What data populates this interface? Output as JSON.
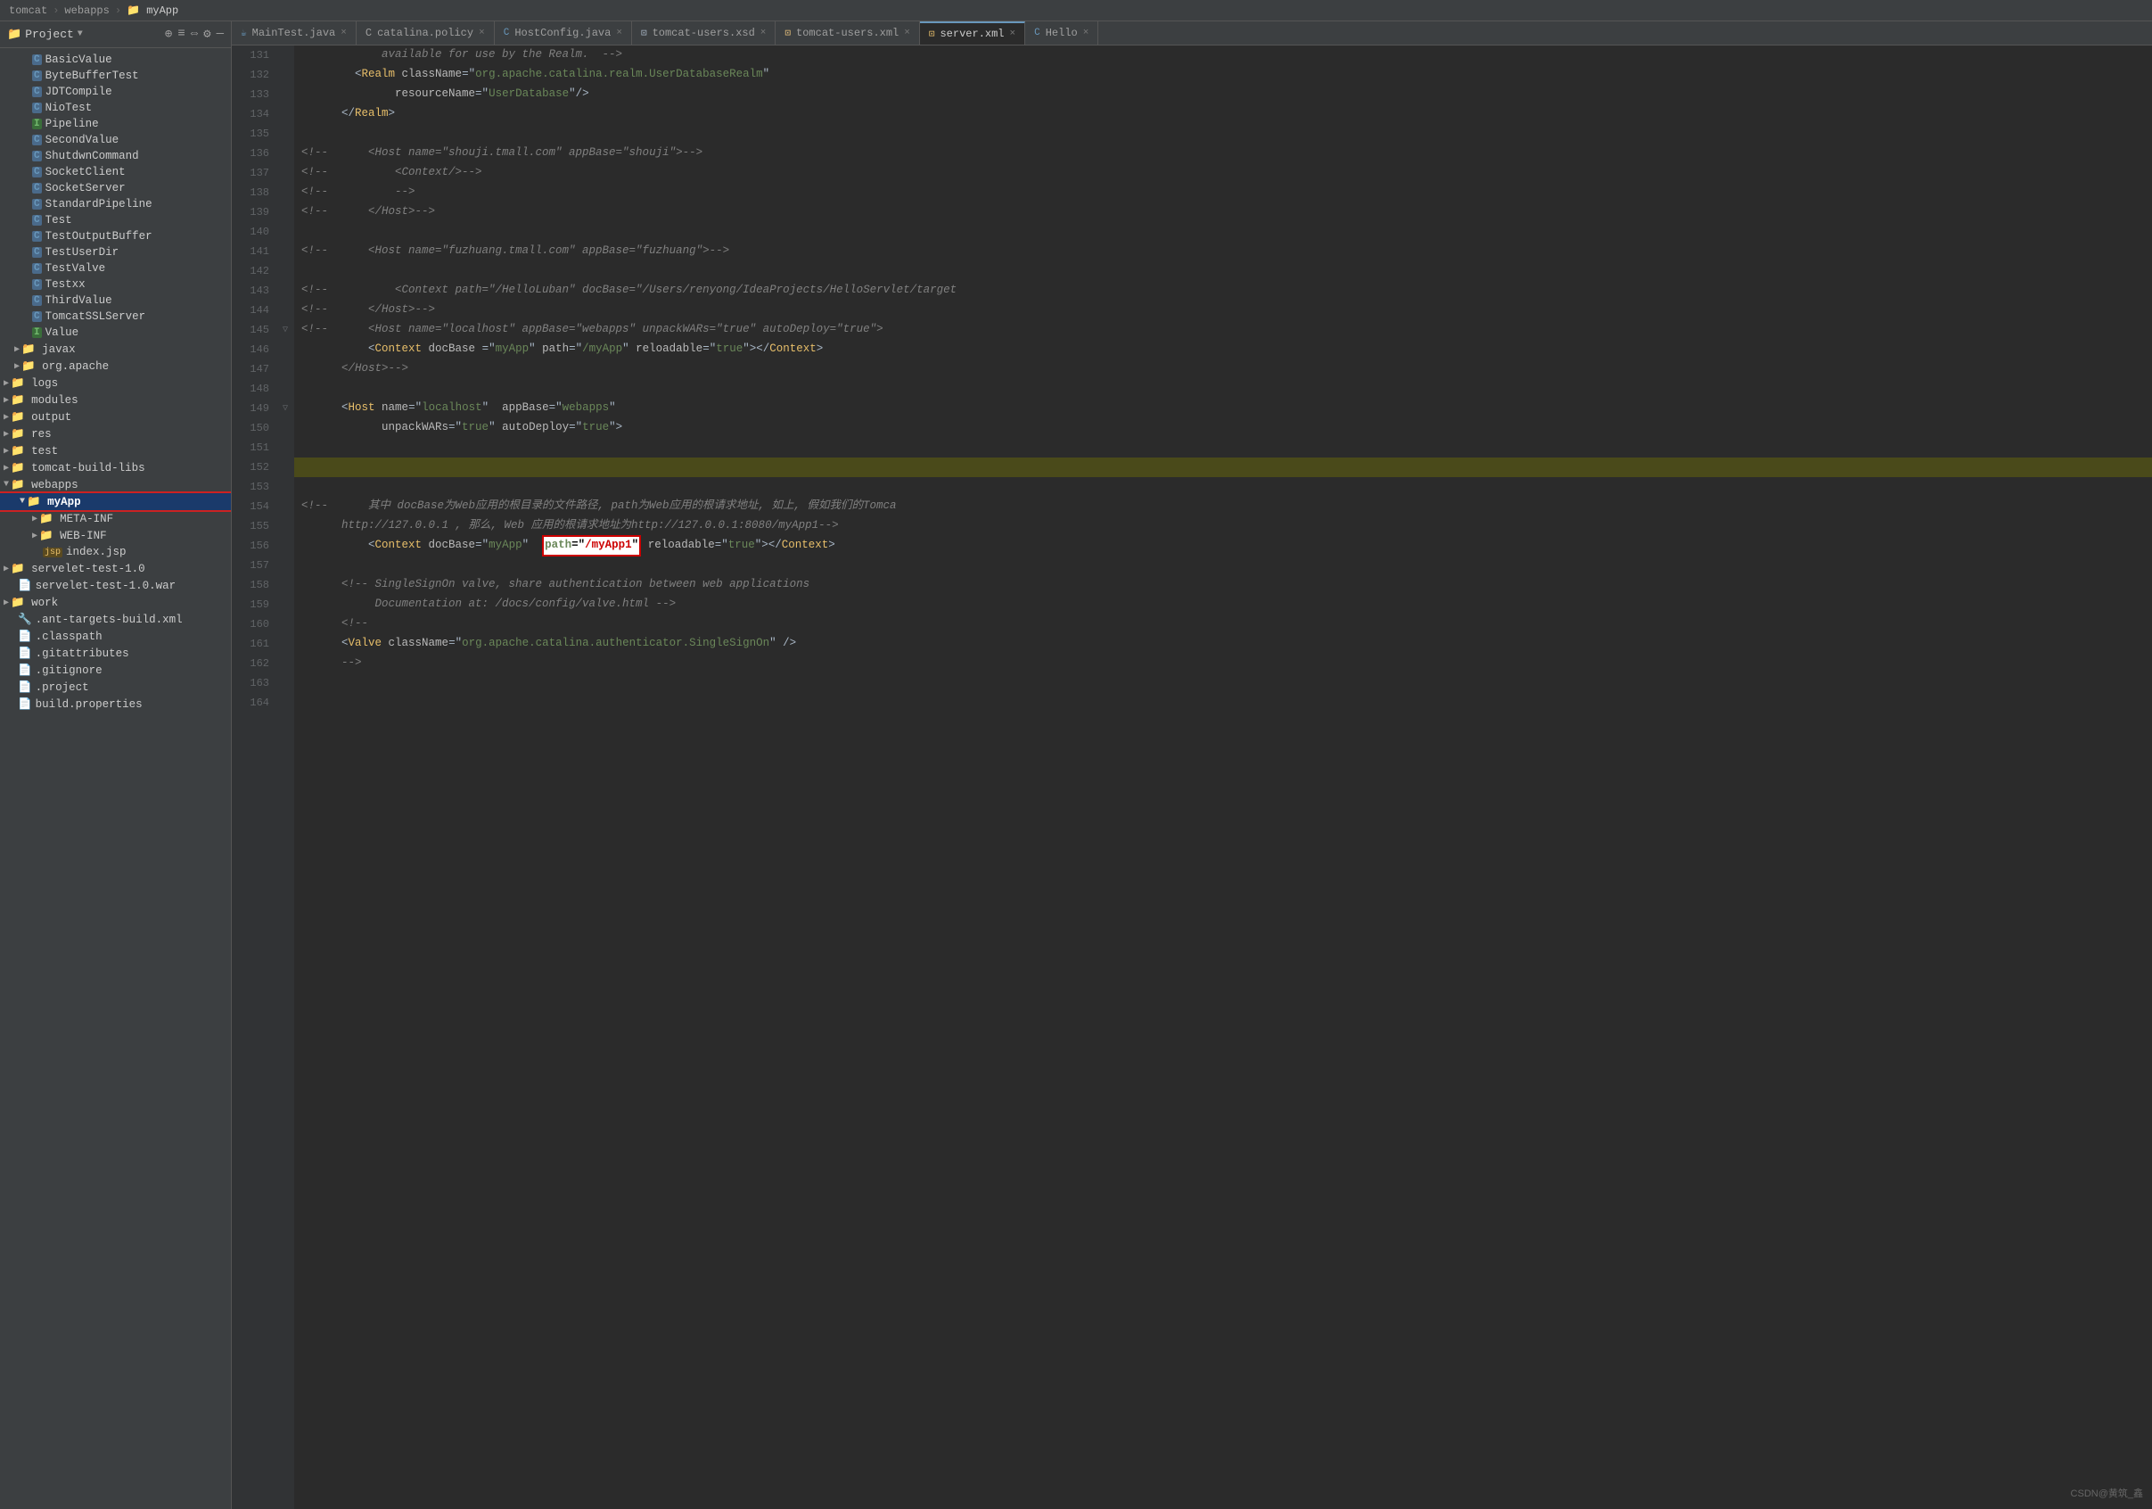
{
  "breadcrumb": {
    "items": [
      "tomcat",
      "webapps",
      "myApp"
    ],
    "separators": [
      ">",
      ">"
    ]
  },
  "sidebar": {
    "title": "Project",
    "tree_items": [
      {
        "id": "basic-value",
        "label": "BasicValue",
        "type": "class",
        "indent": 2
      },
      {
        "id": "byte-buffer-test",
        "label": "ByteBufferTest",
        "type": "class",
        "indent": 2
      },
      {
        "id": "jdt-compile",
        "label": "JDTCompile",
        "type": "class",
        "indent": 2
      },
      {
        "id": "nio-test",
        "label": "NioTest",
        "type": "class",
        "indent": 2
      },
      {
        "id": "pipeline",
        "label": "Pipeline",
        "type": "interface",
        "indent": 2
      },
      {
        "id": "second-value",
        "label": "SecondValue",
        "type": "class",
        "indent": 2
      },
      {
        "id": "shutdwn-command",
        "label": "ShutdwnCommand",
        "type": "class",
        "indent": 2
      },
      {
        "id": "socket-client",
        "label": "SocketClient",
        "type": "class",
        "indent": 2
      },
      {
        "id": "socket-server",
        "label": "SocketServer",
        "type": "class",
        "indent": 2
      },
      {
        "id": "standard-pipeline",
        "label": "StandardPipeline",
        "type": "class",
        "indent": 2
      },
      {
        "id": "test",
        "label": "Test",
        "type": "class",
        "indent": 2
      },
      {
        "id": "test-output-buffer",
        "label": "TestOutputBuffer",
        "type": "class",
        "indent": 2
      },
      {
        "id": "test-user-dir",
        "label": "TestUserDir",
        "type": "class",
        "indent": 2
      },
      {
        "id": "test-valve",
        "label": "TestValve",
        "type": "class",
        "indent": 2
      },
      {
        "id": "testxx",
        "label": "Testxx",
        "type": "class",
        "indent": 2
      },
      {
        "id": "third-value",
        "label": "ThirdValue",
        "type": "class",
        "indent": 2
      },
      {
        "id": "tomcat-ssl-server",
        "label": "TomcatSSLServer",
        "type": "class",
        "indent": 2
      },
      {
        "id": "value",
        "label": "Value",
        "type": "interface",
        "indent": 2
      },
      {
        "id": "javax",
        "label": "javax",
        "type": "folder",
        "indent": 1,
        "arrow": "▶"
      },
      {
        "id": "org-apache",
        "label": "org.apache",
        "type": "folder",
        "indent": 1,
        "arrow": "▶"
      },
      {
        "id": "logs",
        "label": "logs",
        "type": "folder",
        "indent": 0,
        "arrow": "▶"
      },
      {
        "id": "modules",
        "label": "modules",
        "type": "folder",
        "indent": 0,
        "arrow": "▶"
      },
      {
        "id": "output",
        "label": "output",
        "type": "folder",
        "indent": 0,
        "arrow": "▶"
      },
      {
        "id": "res",
        "label": "res",
        "type": "folder",
        "indent": 0,
        "arrow": "▶"
      },
      {
        "id": "test-folder",
        "label": "test",
        "type": "folder",
        "indent": 0,
        "arrow": "▶"
      },
      {
        "id": "tomcat-build-libs",
        "label": "tomcat-build-libs",
        "type": "folder",
        "indent": 0,
        "arrow": "▶"
      },
      {
        "id": "webapps",
        "label": "webapps",
        "type": "folder",
        "indent": 0,
        "arrow": "▼"
      },
      {
        "id": "myapp",
        "label": "myApp",
        "type": "folder-selected",
        "indent": 1,
        "arrow": "▼"
      },
      {
        "id": "meta-inf",
        "label": "META-INF",
        "type": "folder",
        "indent": 2,
        "arrow": "▶"
      },
      {
        "id": "web-inf",
        "label": "WEB-INF",
        "type": "folder",
        "indent": 2,
        "arrow": "▶"
      },
      {
        "id": "index-jsp",
        "label": "index.jsp",
        "type": "jsp",
        "indent": 3
      },
      {
        "id": "servelet-test-10",
        "label": "servelet-test-1.0",
        "type": "folder",
        "indent": 0,
        "arrow": "▶"
      },
      {
        "id": "servelet-test-10-war",
        "label": "servelet-test-1.0.war",
        "type": "file",
        "indent": 1
      },
      {
        "id": "work",
        "label": "work",
        "type": "folder",
        "indent": 0,
        "arrow": "▶"
      },
      {
        "id": "ant-targets",
        "label": ".ant-targets-build.xml",
        "type": "xml",
        "indent": 1
      },
      {
        "id": "classpath",
        "label": ".classpath",
        "type": "file",
        "indent": 1
      },
      {
        "id": "gitattributes",
        "label": ".gitattributes",
        "type": "file",
        "indent": 1
      },
      {
        "id": "gitignore",
        "label": ".gitignore",
        "type": "file",
        "indent": 1
      },
      {
        "id": "project",
        "label": ".project",
        "type": "file",
        "indent": 1
      },
      {
        "id": "build-properties",
        "label": "build.properties",
        "type": "file",
        "indent": 1
      }
    ]
  },
  "tabs": [
    {
      "id": "main-test",
      "label": "MainTest.java",
      "type": "java",
      "active": false
    },
    {
      "id": "catalina-policy",
      "label": "catalina.policy",
      "type": "policy",
      "active": false
    },
    {
      "id": "host-config",
      "label": "HostConfig.java",
      "type": "java",
      "active": false
    },
    {
      "id": "tomcat-users-xsd",
      "label": "tomcat-users.xsd",
      "type": "xsd",
      "active": false
    },
    {
      "id": "tomcat-users-xml",
      "label": "tomcat-users.xml",
      "type": "xml",
      "active": false
    },
    {
      "id": "server-xml",
      "label": "server.xml",
      "type": "xml",
      "active": true
    },
    {
      "id": "hello",
      "label": "Hello",
      "type": "java",
      "active": false
    }
  ],
  "editor": {
    "lines": [
      {
        "num": 131,
        "content": "available for use by the Realm. -->",
        "type": "comment",
        "indent": "                "
      },
      {
        "num": 132,
        "content": "",
        "type": "xml-tag",
        "raw": "        <Realm className=\"org.apache.catalina.realm.UserDatabaseRealm\""
      },
      {
        "num": 133,
        "content": "",
        "type": "xml-attr",
        "raw": "              resourceName=\"UserDatabase\"/>"
      },
      {
        "num": 134,
        "content": "",
        "type": "xml-tag",
        "raw": "      </Realm>"
      },
      {
        "num": 135,
        "content": "",
        "type": "empty"
      },
      {
        "num": 136,
        "content": "",
        "type": "comment-xml",
        "raw": "<!--      <Host name=\"shouji.tmall.com\" appBase=\"shouji\">-->"
      },
      {
        "num": 137,
        "content": "",
        "type": "comment-xml",
        "raw": "<!--          <Context/>-->"
      },
      {
        "num": 138,
        "content": "",
        "type": "comment-xml",
        "raw": "<!--          -->"
      },
      {
        "num": 139,
        "content": "",
        "type": "comment-xml",
        "raw": "<!--      </Host>-->"
      },
      {
        "num": 140,
        "content": "",
        "type": "empty"
      },
      {
        "num": 141,
        "content": "",
        "type": "comment-xml",
        "raw": "<!--      <Host name=\"fuzhuang.tmall.com\" appBase=\"fuzhuang\">-->"
      },
      {
        "num": 142,
        "content": "",
        "type": "empty"
      },
      {
        "num": 143,
        "content": "",
        "type": "comment-xml",
        "raw": "<!--          <Context path=\"/HelloLuban\" docBase=\"/Users/renyong/IdeaProjects/HelloServlet/target"
      },
      {
        "num": 144,
        "content": "",
        "type": "comment-xml",
        "raw": "<!--      </Host>-->"
      },
      {
        "num": 145,
        "content": "",
        "type": "comment-xml",
        "raw": "<!--      <Host name=\"localhost\" appBase=\"webapps\" unpackWARs=\"true\" autoDeploy=\"true\">"
      },
      {
        "num": 146,
        "content": "",
        "type": "xml-normal",
        "raw": "          <Context docBase =\"myApp\" path=\"/myApp\" reloadable=\"true\"></Context>"
      },
      {
        "num": 147,
        "content": "",
        "type": "comment-xml",
        "raw": "      </Host>-->"
      },
      {
        "num": 148,
        "content": "",
        "type": "empty"
      },
      {
        "num": 149,
        "content": "",
        "type": "xml-tag",
        "raw": "      <Host name=\"localhost\"  appBase=\"webapps\""
      },
      {
        "num": 150,
        "content": "",
        "type": "xml-attr",
        "raw": "            unpackWARs=\"true\" autoDeploy=\"true\">"
      },
      {
        "num": 151,
        "content": "",
        "type": "empty"
      },
      {
        "num": 152,
        "content": "",
        "type": "highlighted"
      },
      {
        "num": 153,
        "content": "",
        "type": "empty"
      },
      {
        "num": 154,
        "content": "",
        "type": "comment-zh",
        "raw": "<!--      其中 docBase为Web应用的根目录的文件路径, path为Web应用的根请求地址, 如上, 假如我们的Tomca"
      },
      {
        "num": 155,
        "content": "",
        "type": "comment-zh2",
        "raw": "      http://127.0.0.1 , 那么, Web 应用的根请求地址为http://127.0.0.1:8080/myApp1-->"
      },
      {
        "num": 156,
        "content": "",
        "type": "xml-highlight",
        "raw": "          <Context docBase=\"myApp\"  path=\"/myApp1\" reloadable=\"true\"></Context>"
      },
      {
        "num": 157,
        "content": "",
        "type": "empty"
      },
      {
        "num": 158,
        "content": "",
        "type": "comment-xml",
        "raw": "      <!-- SingleSignOn valve, share authentication between web applications"
      },
      {
        "num": 159,
        "content": "",
        "type": "comment-xml2",
        "raw": "           Documentation at: /docs/config/valve.html -->"
      },
      {
        "num": 160,
        "content": "",
        "type": "comment-xml",
        "raw": "      <!--"
      },
      {
        "num": 161,
        "content": "",
        "type": "xml-tag",
        "raw": "      <Valve className=\"org.apache.catalina.authenticator.SingleSignOn\" />"
      },
      {
        "num": 162,
        "content": "",
        "type": "comment-xml",
        "raw": "      -->"
      },
      {
        "num": 163,
        "content": "",
        "type": "empty"
      },
      {
        "num": 164,
        "content": "",
        "type": "empty"
      }
    ]
  },
  "watermark": "CSDN@黄筑_鑫"
}
